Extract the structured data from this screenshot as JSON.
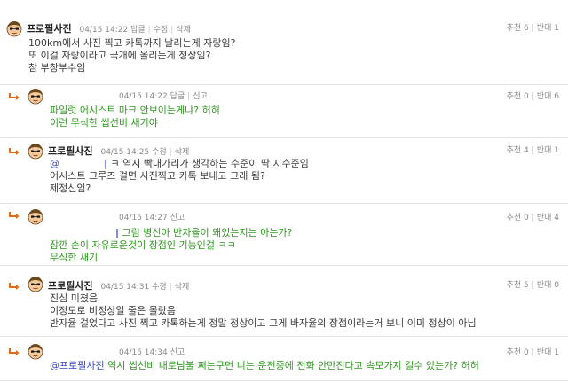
{
  "labels": {
    "reply": "답글",
    "edit": "수정",
    "delete": "삭제",
    "report": "신고",
    "recommend": "추천",
    "oppose": "반대"
  },
  "colors": {
    "green_text": "#2e9a1e",
    "dark_text": "#3a3a3a",
    "mention": "#3346c8",
    "reply_arrow": "#e06a1a"
  },
  "comments": [
    {
      "nickname": "프로필사진",
      "date": "04/15 14:22",
      "recommend": "6",
      "oppose": "1",
      "lines": [
        "100km에서 사진 찍고 카톡까지 날리는게 자랑임?",
        "또 이걸 자랑이라고 국개에 올리는게 정상임?",
        "참 부창부수임"
      ]
    },
    {
      "nickname": "",
      "date": "04/15 14:22",
      "recommend": "0",
      "oppose": "6",
      "lines": [
        "파일럿 어시스트 마크 안보이는게냐? 허허",
        "이런 무식한 씹선비 새기야"
      ]
    },
    {
      "nickname": "프로필사진",
      "date": "04/15 14:25",
      "recommend": "4",
      "oppose": "1",
      "mention": "@",
      "first_line": "ㅋ 역시 빡대가리가 생각하는 수준이 딱 지수준임",
      "lines": [
        "어시스트 크루즈 걸면 사진찍고 카톡 보내고 그래 됨?",
        "제정신임?"
      ]
    },
    {
      "nickname": "",
      "date": "04/15 14:27",
      "recommend": "0",
      "oppose": "4",
      "first_line": "그럼 병신아 반자율이 왜있는지는 아는가?",
      "lines": [
        "잠깐 손이 자유로운것이 장점인 기능인걸 ㅋㅋ",
        "무식한 새기"
      ]
    },
    {
      "nickname": "프로필사진",
      "date": "04/15 14:31",
      "recommend": "5",
      "oppose": "0",
      "lines": [
        "진심 미쳤음",
        "이정도로 비정상일 줄은 몰랐음",
        "반자율 걸었다고 사진 찍고 카톡하는게 정말 정상이고 그게 바자율의 장점이라는거 보니 이미 정상이 아님"
      ]
    },
    {
      "nickname": "",
      "date": "04/15 14:34",
      "recommend": "0",
      "oppose": "1",
      "mention": "@프로필사진",
      "first_line": "역시 씹선비 내로남불 쩌는구먼 니는 운전중에 전화 안만진다고 속모가지 걸수 있는가? 허허"
    }
  ]
}
